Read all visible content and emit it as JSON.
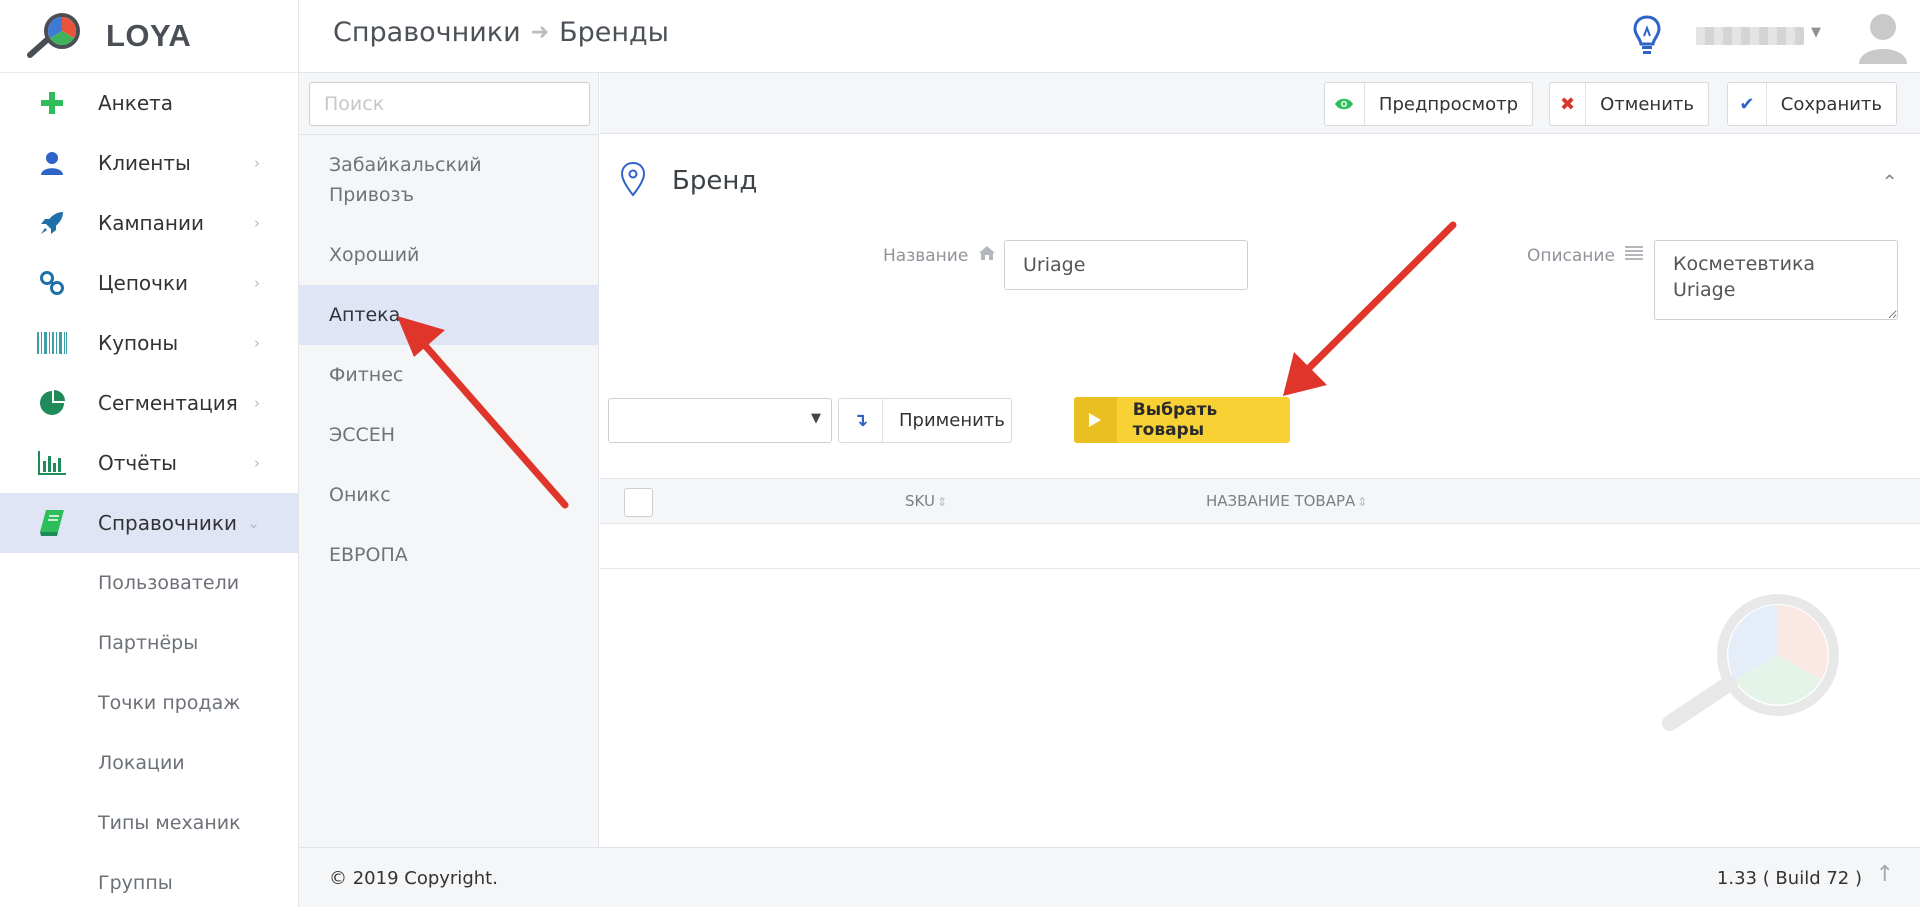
{
  "app": {
    "brand": "LOYA"
  },
  "header": {
    "breadcrumb_root": "Справочники",
    "breadcrumb_current": "Бренды"
  },
  "sidebar": {
    "items": [
      {
        "label": "Анкета",
        "icon": "plus-icon"
      },
      {
        "label": "Клиенты",
        "icon": "user-icon"
      },
      {
        "label": "Кампании",
        "icon": "rocket-icon"
      },
      {
        "label": "Цепочки",
        "icon": "link-icon"
      },
      {
        "label": "Купоны",
        "icon": "barcode-icon"
      },
      {
        "label": "Сегментация",
        "icon": "pie-chart-icon"
      },
      {
        "label": "Отчёты",
        "icon": "bar-chart-icon"
      },
      {
        "label": "Справочники",
        "icon": "book-icon"
      }
    ],
    "subitems": [
      "Пользователи",
      "Партнёры",
      "Точки продаж",
      "Локации",
      "Типы механик",
      "Группы"
    ]
  },
  "list": {
    "search_placeholder": "Поиск",
    "brands": [
      "Забайкальский Привозъ",
      "Хороший",
      "Аптека",
      "Фитнес",
      "ЭССЕН",
      "Оникс",
      "ЕВРОПА"
    ],
    "selected": "Аптека"
  },
  "toolbar": {
    "preview_label": "Предпросмотр",
    "cancel_label": "Отменить",
    "save_label": "Сохранить"
  },
  "form": {
    "section_title": "Бренд",
    "name_label": "Название",
    "name_value": "Uriage",
    "desc_label": "Описание",
    "desc_value": "Косметевтика Uriage"
  },
  "actions": {
    "apply_label": "Применить",
    "choose_label": "Выбрать товары"
  },
  "table": {
    "col_sku": "SKU",
    "col_name": "НАЗВАНИЕ ТОВАРА"
  },
  "footer": {
    "copyright": "© 2019 Copyright.",
    "version": "1.33 ( Build 72 )"
  },
  "colors": {
    "accent": "#2f63c8",
    "active_bg": "#dfe5f5",
    "choose_btn": "#f8d235",
    "arrow": "#e0352b",
    "green": "#2ebd5b"
  }
}
